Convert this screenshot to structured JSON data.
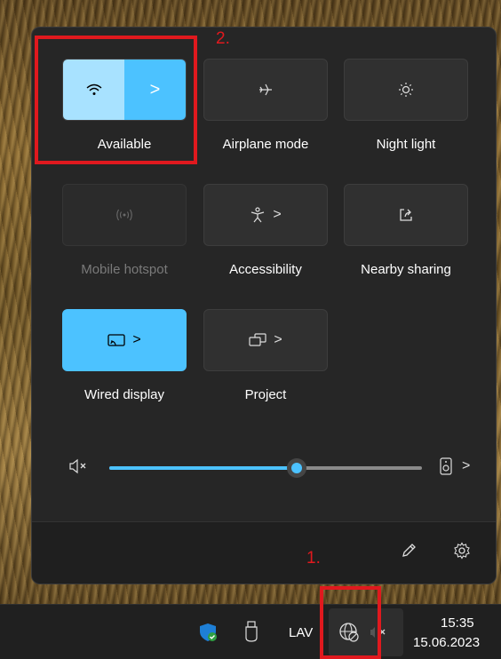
{
  "quick_settings": {
    "tiles": [
      {
        "label": "Available",
        "icon": "wifi-icon",
        "state": "on",
        "has_chevron": true
      },
      {
        "label": "Airplane mode",
        "icon": "airplane-icon",
        "state": "off"
      },
      {
        "label": "Night light",
        "icon": "brightness-icon",
        "state": "off"
      },
      {
        "label": "Mobile hotspot",
        "icon": "hotspot-icon",
        "state": "disabled"
      },
      {
        "label": "Accessibility",
        "icon": "accessibility-icon",
        "state": "off",
        "has_chevron": true
      },
      {
        "label": "Nearby sharing",
        "icon": "share-icon",
        "state": "off"
      },
      {
        "label": "Wired display",
        "icon": "cast-icon",
        "state": "on",
        "has_chevron": true
      },
      {
        "label": "Project",
        "icon": "project-icon",
        "state": "off",
        "has_chevron": true
      }
    ],
    "volume": {
      "level_fraction": 0.6,
      "muted_icon": "speaker-muted-icon",
      "output_icon": "speaker-device-icon"
    },
    "footer": {
      "edit_icon": "pencil-icon",
      "settings_icon": "gear-icon"
    },
    "chevron": ">"
  },
  "taskbar": {
    "language": "LAV",
    "time": "15:35",
    "date": "15.06.2023",
    "icons": [
      "defender-shield-icon",
      "usb-drive-icon",
      "globe-no-network-icon",
      "volume-muted-icon"
    ]
  },
  "annotations": {
    "step1": "1.",
    "step2": "2."
  },
  "colors": {
    "accent": "#4cc2ff",
    "annotation_red": "#e0191e",
    "panel_bg": "#262626"
  }
}
